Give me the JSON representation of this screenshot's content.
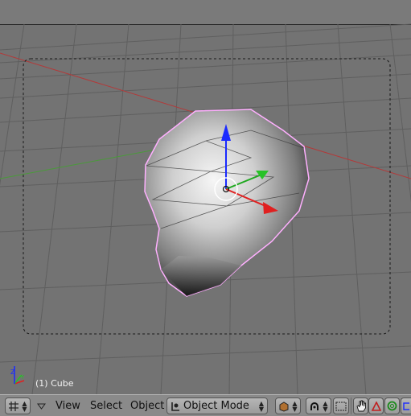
{
  "viewport": {
    "object_label": "(1) Cube"
  },
  "toolbar": {
    "view_menu": "View",
    "select_menu": "Select",
    "object_menu": "Object",
    "mode_selector": "Object Mode",
    "icons": {
      "editor_type": "grid-icon",
      "menu_toggle": "triangle-down-icon",
      "mode": "object-mode-icon",
      "draw_type": "solid-draw-icon",
      "pivot": "pivot-icon",
      "layers": "layers-icon",
      "manipulator_toggle": "hand-icon",
      "translate": "translate-icon",
      "rotate": "rotate-icon"
    }
  },
  "colors": {
    "viewport_bg": "#737373",
    "grid_line": "#5f5f5f",
    "x_axis": "#b23a3a",
    "y_axis": "#4a9a3a",
    "z_arrow": "#1a2aff",
    "outline": "#ffb0ff"
  }
}
